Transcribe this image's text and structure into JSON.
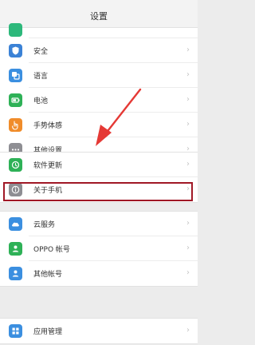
{
  "header": {
    "title": "设置"
  },
  "status_bar": {
    "left_text": "",
    "right_text": ""
  },
  "groups": [
    {
      "items": [
        {
          "label": "",
          "icon": "partial-green-icon",
          "color": "#2db87b"
        },
        {
          "label": "安全",
          "icon": "shield-icon",
          "color": "#3b82d6"
        },
        {
          "label": "语言",
          "icon": "language-icon",
          "color": "#3b8fe0"
        },
        {
          "label": "电池",
          "icon": "battery-icon",
          "color": "#2eb157"
        },
        {
          "label": "手势体感",
          "icon": "gesture-icon",
          "color": "#f08c2a"
        },
        {
          "label": "其他设置",
          "icon": "more-icon",
          "color": "#8e8e93"
        }
      ]
    },
    {
      "items": [
        {
          "label": "软件更新",
          "icon": "update-icon",
          "color": "#2eb157"
        },
        {
          "label": "关于手机",
          "icon": "info-icon",
          "color": "#8e8e93"
        }
      ]
    },
    {
      "items": [
        {
          "label": "云服务",
          "icon": "cloud-icon",
          "color": "#3b8fe0"
        },
        {
          "label": "OPPO 帐号",
          "icon": "account-icon",
          "color": "#2eb157"
        },
        {
          "label": "其他帐号",
          "icon": "user-icon",
          "color": "#3b8fe0"
        }
      ]
    },
    {
      "items": [
        {
          "label": "应用管理",
          "icon": "apps-icon",
          "color": "#3b8fe0"
        }
      ]
    }
  ],
  "annotation": {
    "highlight_color": "#a01826",
    "arrow_color": "#e53935"
  },
  "chevron_glyph": "›"
}
